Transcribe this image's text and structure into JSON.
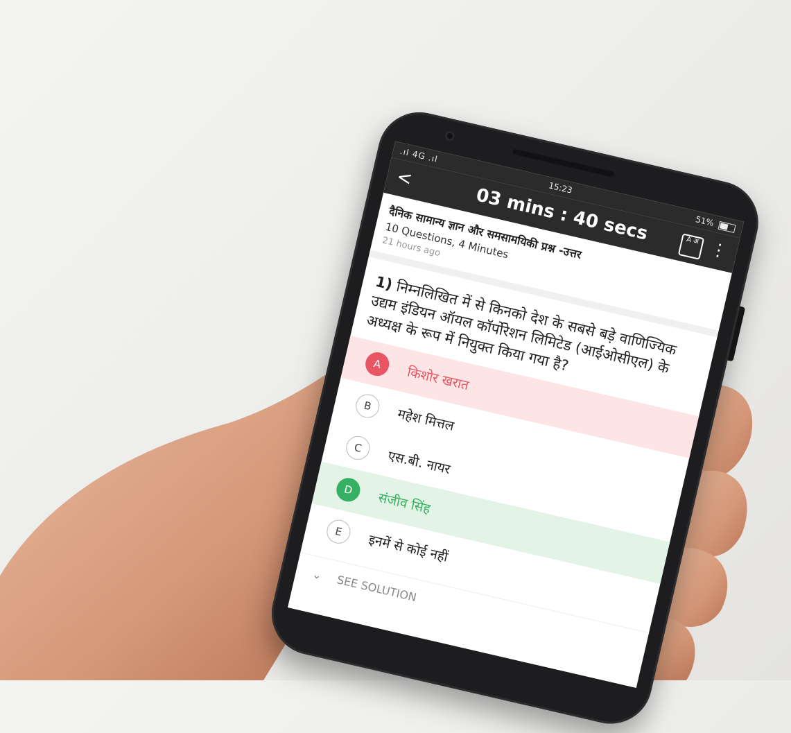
{
  "status_bar": {
    "signal": ".ıl 4G .ıl",
    "time": "15:23",
    "battery": "51%"
  },
  "toolbar": {
    "back_label": "<",
    "timer": "03 mins : 40 secs",
    "language_toggle": "A अ",
    "menu_label": "⋮"
  },
  "quiz": {
    "title": "दैनिक सामान्य ज्ञान और समसामयिकी  प्रश्न -उत्तर",
    "meta": "10 Questions, 4 Minutes",
    "posted": "21 hours ago"
  },
  "question": {
    "number": "1)",
    "text": "निम्नलिखित में से किनको देश के सबसे बड़े वाणिज्यिक उद्यम इंडियन ऑयल कॉर्पोरेशन लिमिटेड (आईओसीएल) के अध्यक्ष के रूप में नियुक्त किया गया है?"
  },
  "options": [
    {
      "letter": "A",
      "text": "किशोर खरात",
      "state": "wrong"
    },
    {
      "letter": "B",
      "text": "महेश मित्तल",
      "state": "none"
    },
    {
      "letter": "C",
      "text": "एस.बी. नायर",
      "state": "none"
    },
    {
      "letter": "D",
      "text": "संजीव सिंह",
      "state": "correct"
    },
    {
      "letter": "E",
      "text": "इनमें से कोई नहीं",
      "state": "none"
    }
  ],
  "solution_label": "SEE SOLUTION",
  "colors": {
    "toolbar": "#2b2b2b",
    "wrong": "#e85563",
    "correct": "#36b062",
    "wrong_bg": "#fde4e5",
    "correct_bg": "#e3f3e6"
  }
}
